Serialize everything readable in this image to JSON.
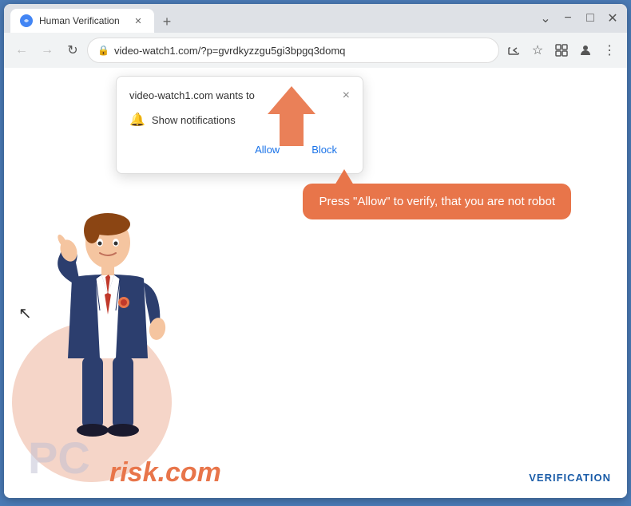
{
  "window": {
    "title": "Human Verification",
    "background_color": "#4a7ab5"
  },
  "titlebar": {
    "tab_title": "Human Verification",
    "new_tab_label": "+",
    "close_label": "✕",
    "minimize_label": "−",
    "maximize_label": "□",
    "chevron_down": "⌄"
  },
  "navbar": {
    "back_icon": "←",
    "forward_icon": "→",
    "refresh_icon": "↻",
    "url": "video-watch1.com/?p=gvrdkyzzgu5gi3bpgq3domq",
    "share_icon": "⎙",
    "bookmark_icon": "☆",
    "extensions_icon": "□",
    "account_icon": "👤",
    "menu_icon": "⋮"
  },
  "popup": {
    "title": "video-watch1.com wants to",
    "close_icon": "×",
    "notification_label": "Show notifications",
    "allow_button": "Allow",
    "block_button": "Block"
  },
  "speech_bubble": {
    "text": "Press \"Allow\" to verify, that you are not robot"
  },
  "watermark": {
    "logo_text": "PC",
    "domain_text": "risk.com"
  },
  "badge": {
    "text": "VERIFICATION"
  },
  "colors": {
    "accent_orange": "#e8754a",
    "browser_blue": "#4a7ab5",
    "tab_bg": "#dee1e6",
    "badge_blue": "#1a5ca8"
  }
}
